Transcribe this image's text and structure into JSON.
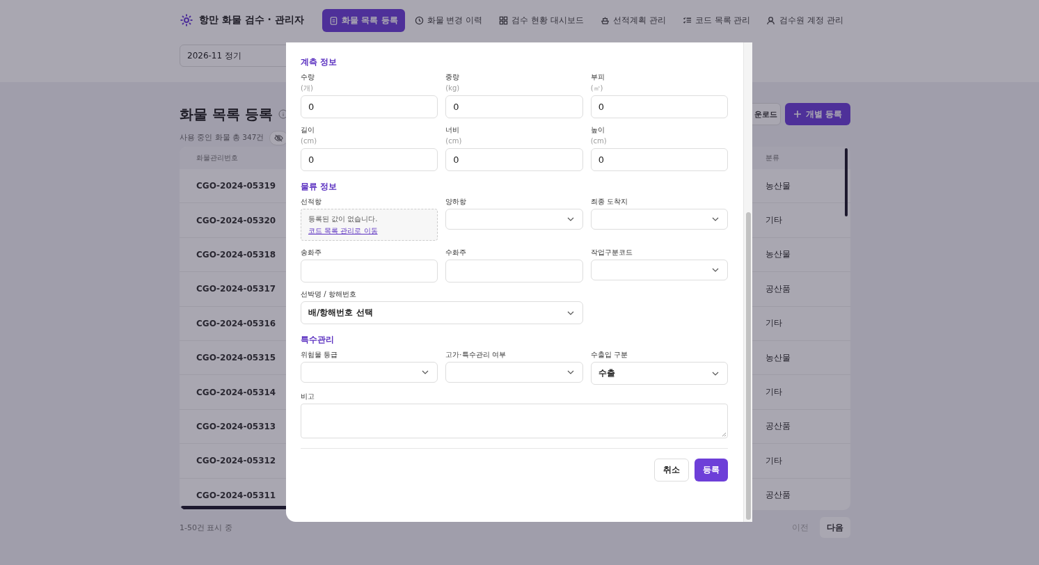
{
  "app": {
    "title": "항만 화물 검수 · 관리자"
  },
  "nav": [
    {
      "label": "화물 목록 등록",
      "selected": true
    },
    {
      "label": "화물 변경 이력",
      "selected": false
    },
    {
      "label": "검수 현황 대시보드",
      "selected": false
    },
    {
      "label": "선적계획 관리",
      "selected": false
    },
    {
      "label": "코드 목록 관리",
      "selected": false
    },
    {
      "label": "검수원 계정 관리",
      "selected": false
    }
  ],
  "filter": {
    "value": "2026-11 정기"
  },
  "page": {
    "title": "화물 목록 등록",
    "summary": "사용 중인 화물 총 347건"
  },
  "toolbar_buttons": [
    {
      "label": "운로드",
      "kind": "secondary"
    },
    {
      "label": "개별 등록",
      "kind": "primary"
    }
  ],
  "table": {
    "columns": [
      "화물관리번호",
      "분류"
    ],
    "rows": [
      [
        "CGO-2024-05319",
        "농산물"
      ],
      [
        "CGO-2024-05320",
        "기타"
      ],
      [
        "CGO-2024-05318",
        "농산물"
      ],
      [
        "CGO-2024-05317",
        "공산품"
      ],
      [
        "CGO-2024-05316",
        "기타"
      ],
      [
        "CGO-2024-05315",
        "농산물"
      ],
      [
        "CGO-2024-05314",
        "기타"
      ],
      [
        "CGO-2024-05313",
        "공산품"
      ],
      [
        "CGO-2024-05312",
        "기타"
      ],
      [
        "CGO-2024-05311",
        "공산품"
      ]
    ]
  },
  "pagination": {
    "info": "1-50건 표시 중",
    "buttons": [
      {
        "label": "이전",
        "disabled": true
      },
      {
        "label": "다음",
        "disabled": false
      }
    ]
  },
  "modal": {
    "sections": [
      {
        "title": "계측 정보",
        "fields": [
          {
            "kind": "input",
            "label": "수량",
            "unit": "(개)",
            "value": "0"
          },
          {
            "kind": "input",
            "label": "중량",
            "unit": "(kg)",
            "value": "0"
          },
          {
            "kind": "input",
            "label": "부피",
            "unit": "(㎥)",
            "value": "0"
          },
          {
            "kind": "input",
            "label": "길이",
            "unit": "(cm)",
            "value": "0"
          },
          {
            "kind": "input",
            "label": "너비",
            "unit": "(cm)",
            "value": "0"
          },
          {
            "kind": "input",
            "label": "높이",
            "unit": "(cm)",
            "value": "0"
          }
        ]
      },
      {
        "title": "물류 정보",
        "fields": [
          {
            "kind": "empty",
            "label": "선적항",
            "message": "등록된 값이 없습니다.",
            "link": "코드 목록 관리로 이동"
          },
          {
            "kind": "select",
            "label": "양하항"
          },
          {
            "kind": "select",
            "label": "최종 도착지"
          },
          {
            "kind": "input",
            "label": "송화주"
          },
          {
            "kind": "input",
            "label": "수화주"
          },
          {
            "kind": "select",
            "label": "작업구분코드"
          },
          {
            "kind": "select",
            "label": "선박명 / 항해번호",
            "value": "배/항해번호 선택",
            "wide": true
          }
        ]
      },
      {
        "title": "특수관리",
        "fields": [
          {
            "kind": "select",
            "label": "위험물 등급"
          },
          {
            "kind": "select",
            "label": "고가·특수관리 여부"
          },
          {
            "kind": "select",
            "label": "수출입 구분",
            "value": "수출"
          },
          {
            "kind": "textarea",
            "label": "비고",
            "full": true
          }
        ]
      }
    ],
    "buttons": [
      {
        "label": "취소",
        "kind": "secondary"
      },
      {
        "label": "등록",
        "kind": "primary"
      }
    ]
  }
}
